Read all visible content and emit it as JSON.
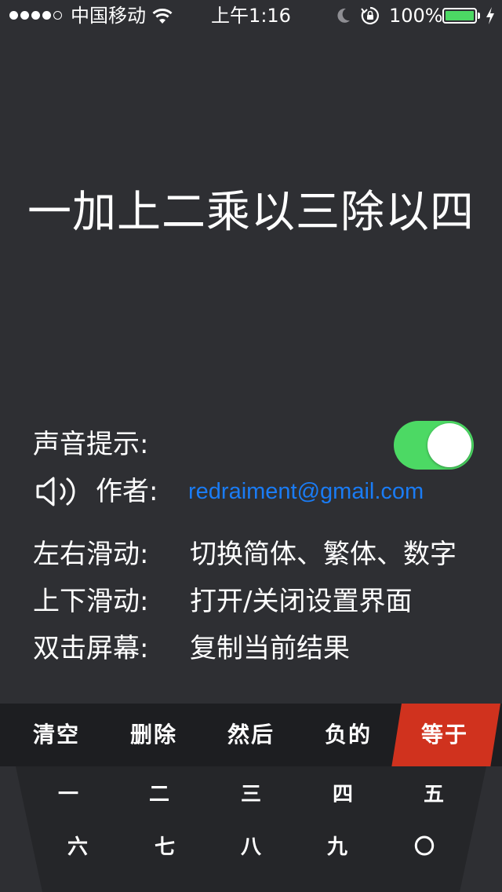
{
  "status_bar": {
    "carrier": "中国移动",
    "time": "上午1:16",
    "battery_percent": "100%",
    "battery_level": 1.0,
    "signal_bars_filled": 4,
    "signal_bars_total": 5,
    "icons": [
      "wifi-icon",
      "moon-icon",
      "rotation-lock-icon",
      "battery-icon",
      "charging-icon"
    ]
  },
  "display": {
    "expression": "一加上二乘以三除以四"
  },
  "settings": {
    "sound_label": "声音提示:",
    "sound_enabled": true,
    "author_label": "作者:",
    "author_email": "redraiment@gmail.com",
    "swipe_lr_label": "左右滑动:",
    "swipe_lr_desc": "切换简体、繁体、数字",
    "swipe_ud_label": "上下滑动:",
    "swipe_ud_desc": "打开/关闭设置界面",
    "double_tap_label": "双击屏幕:",
    "double_tap_desc": "复制当前结果"
  },
  "keypad": {
    "top_row": [
      "清空",
      "删除",
      "然后",
      "负的"
    ],
    "equals": "等于",
    "row1": [
      "一",
      "二",
      "三",
      "四",
      "五"
    ],
    "row2": [
      "六",
      "七",
      "八",
      "九",
      "〇"
    ]
  },
  "colors": {
    "background": "#2e2f33",
    "toggle_on": "#4cd964",
    "link": "#1a7cf5",
    "equals_key": "#d0321e",
    "keypad_top": "#1d1e21"
  }
}
